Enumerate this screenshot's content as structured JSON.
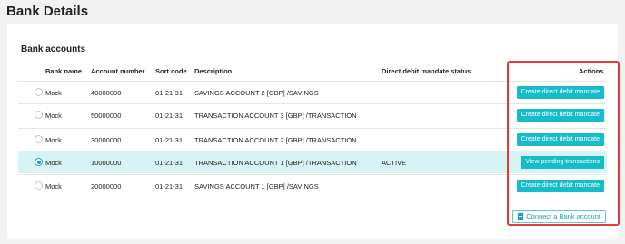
{
  "page": {
    "title": "Bank Details"
  },
  "bank_accounts": {
    "title": "Bank accounts",
    "columns": {
      "bank_name": "Bank name",
      "account_number": "Account number",
      "sort_code": "Sort code",
      "description": "Description",
      "mandate_status": "Direct debit mandate status",
      "actions": "Actions"
    },
    "rows": [
      {
        "bank_name": "Mock",
        "account_number": "40000000",
        "sort_code": "01-21-31",
        "description": "SAVINGS ACCOUNT 2 [GBP] /SAVINGS",
        "mandate_status": "",
        "action": "Create direct debit mandate",
        "selected": false
      },
      {
        "bank_name": "Mock",
        "account_number": "50000000",
        "sort_code": "01-21-31",
        "description": "TRANSACTION ACCOUNT 3 [GBP] /TRANSACTION",
        "mandate_status": "",
        "action": "Create direct debit mandate",
        "selected": false
      },
      {
        "bank_name": "Mock",
        "account_number": "30000000",
        "sort_code": "01-21-31",
        "description": "TRANSACTION ACCOUNT 2 [GBP] /TRANSACTION",
        "mandate_status": "",
        "action": "Create direct debit mandate",
        "selected": false
      },
      {
        "bank_name": "Mock",
        "account_number": "10000000",
        "sort_code": "01-21-31",
        "description": "TRANSACTION ACCOUNT 1 [GBP] /TRANSACTION",
        "mandate_status": "ACTIVE",
        "action": "View pending transactions",
        "selected": true
      },
      {
        "bank_name": "Mock",
        "account_number": "20000000",
        "sort_code": "01-21-31",
        "description": "SAVINGS ACCOUNT 1 [GBP] /SAVINGS",
        "mandate_status": "",
        "action": "Create direct debit mandate",
        "selected": false
      }
    ],
    "connect_button": "Connect a Bank account"
  },
  "colors": {
    "accent": "#17bcc9",
    "selected_row": "#d7f3f5",
    "highlight_box": "#e53935"
  },
  "icons": {
    "connect": "file-icon"
  }
}
